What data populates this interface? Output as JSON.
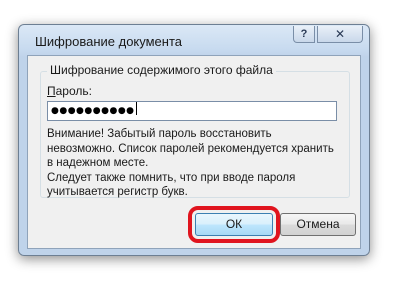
{
  "window": {
    "title": "Шифрование документа",
    "help_label": "?",
    "close_label": "✕"
  },
  "group": {
    "legend": "Шифрование содержимого этого файла",
    "password_label_prefix": "П",
    "password_label_rest": "ароль:",
    "password_value": "●●●●●●●●●●"
  },
  "warning": {
    "lines": [
      "Внимание! Забытый пароль восстановить",
      "невозможно. Список паролей рекомендуется хранить",
      "в надежном месте.",
      "Следует также помнить, что при вводе пароля",
      "учитывается регистр букв."
    ]
  },
  "buttons": {
    "ok_label": "ОК",
    "cancel_label": "Отмена"
  },
  "colors": {
    "highlight": "#e0141e",
    "title_bar": "#c7daef"
  }
}
